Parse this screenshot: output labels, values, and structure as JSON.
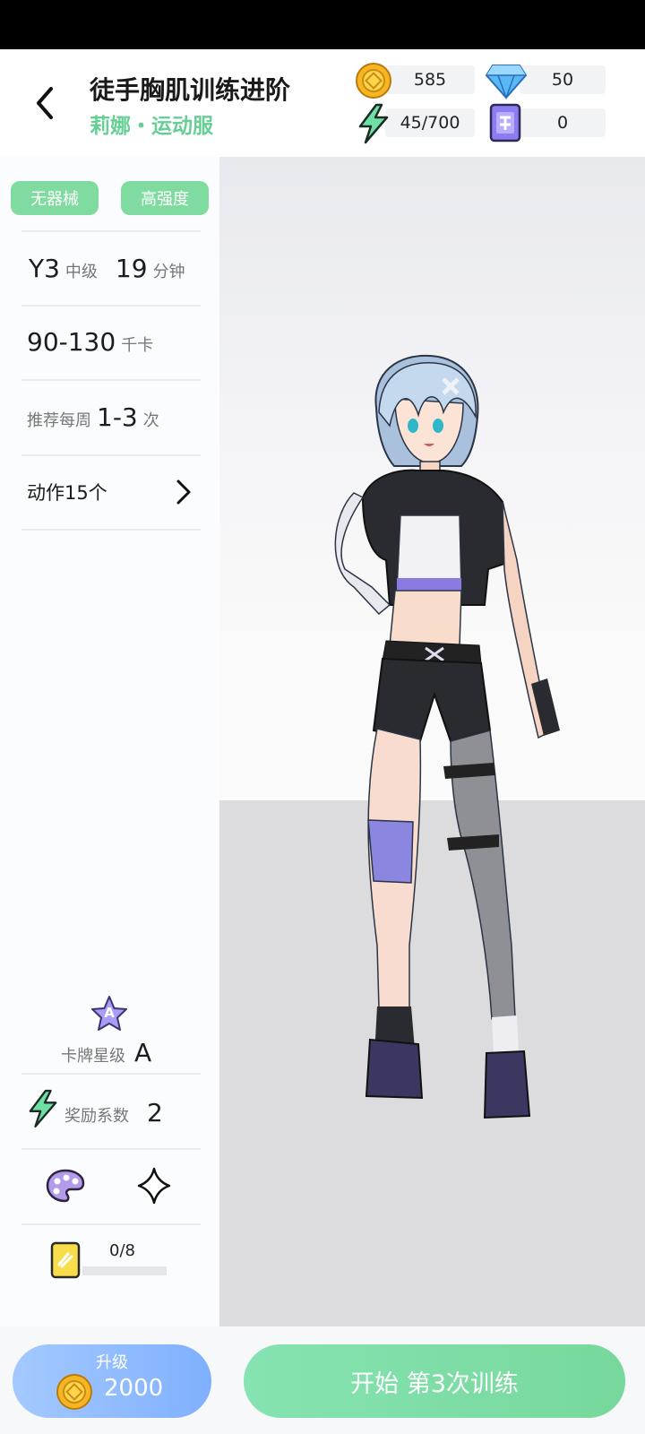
{
  "header": {
    "title": "徒手胸肌训练进阶",
    "subtitle": "莉娜・运动服"
  },
  "resources": {
    "coins": "585",
    "diamonds": "50",
    "energy": "45/700",
    "tickets": "0"
  },
  "sidebar": {
    "tags": [
      "无器械",
      "高强度"
    ],
    "level_value": "Y3",
    "level_label": "中级",
    "duration_value": "19",
    "duration_unit": "分钟",
    "calories_value": "90-130",
    "calories_unit": "千卡",
    "frequency_label": "推荐每周",
    "frequency_value": "1-3",
    "frequency_unit": "次",
    "actions_label": "动作15个",
    "star_badge": "A",
    "card_star_label": "卡牌星级",
    "card_star_value": "A",
    "reward_label": "奖励系数",
    "reward_value": "2",
    "shards": "0/8",
    "shard_progress": 0
  },
  "bottom": {
    "upgrade_label": "升级",
    "upgrade_cost": "2000",
    "start_label": "开始 第3次训练"
  },
  "colors": {
    "accent_green": "#66cf96",
    "tag_green": "#7fdb9f",
    "upgrade_blue": "#8fbcff",
    "start_green": "#7ddda5"
  },
  "icons": [
    "back-arrow-icon",
    "coin-icon",
    "diamond-icon",
    "energy-icon",
    "ticket-icon",
    "chevron-right-icon",
    "star-badge-icon",
    "palette-icon",
    "diamond-outline-icon",
    "shard-card-icon"
  ]
}
